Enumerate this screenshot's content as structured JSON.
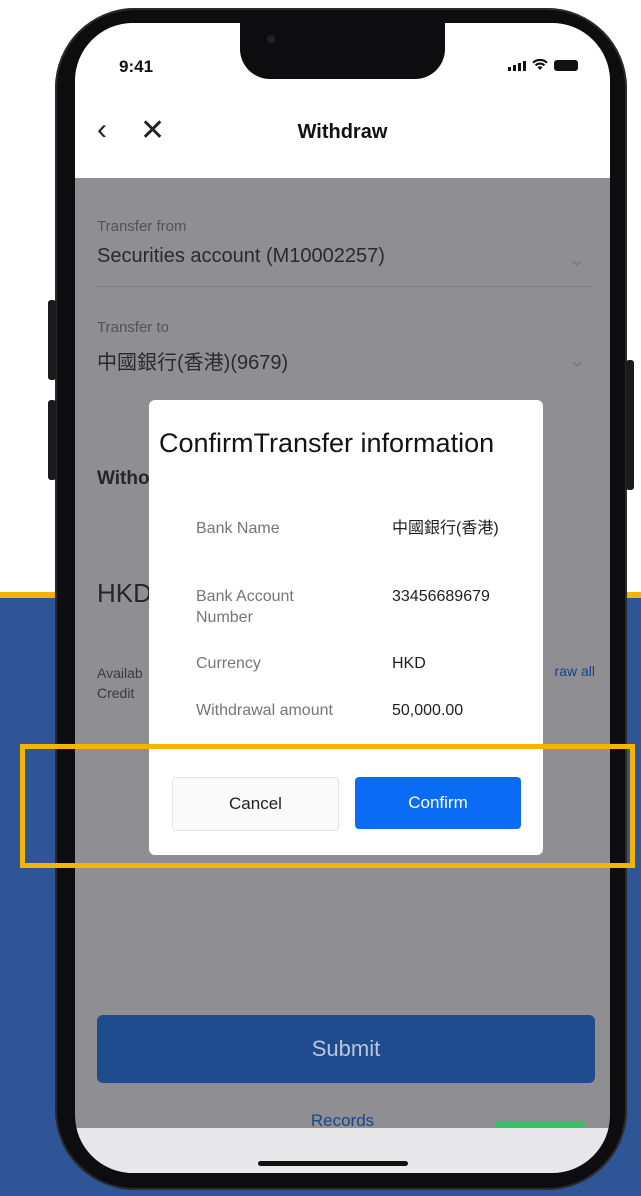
{
  "status": {
    "time": "9:41"
  },
  "header": {
    "title": "Withdraw",
    "back_icon": "chevron-left-icon",
    "close_icon": "close-icon"
  },
  "form": {
    "from_label": "Transfer from",
    "from_value": "Securities account (M10002257)",
    "to_label": "Transfer to",
    "to_value": "中國銀行(香港)(9679)",
    "amount_label_partial": "Witho",
    "currency_partial": "HKD",
    "available_partial": "Availab",
    "credit_partial": "Credit",
    "withdraw_all_partial": "raw all"
  },
  "modal": {
    "title": "ConfirmTransfer information",
    "rows": [
      {
        "key": "Bank Name",
        "value": "中國銀行(香港)"
      },
      {
        "key": "Bank Account Number",
        "value": "33456689679"
      },
      {
        "key": "Currency",
        "value": "HKD"
      },
      {
        "key": "Withdrawal amount",
        "value": "50,000.00"
      }
    ],
    "cancel_label": "Cancel",
    "confirm_label": "Confirm"
  },
  "footer": {
    "submit_label": "Submit",
    "records_label": "Records"
  },
  "colors": {
    "accent": "#0a6cf5",
    "highlight": "#f5b400",
    "submit": "#214b8f",
    "background_blue": "#2f5597"
  }
}
